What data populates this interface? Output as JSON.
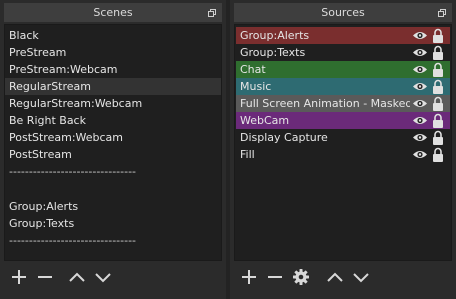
{
  "scenes": {
    "title": "Scenes",
    "items": [
      {
        "label": "Black",
        "selected": false
      },
      {
        "label": "PreStream",
        "selected": false
      },
      {
        "label": "PreStream:Webcam",
        "selected": false
      },
      {
        "label": "RegularStream",
        "selected": true
      },
      {
        "label": "RegularStream:Webcam",
        "selected": false
      },
      {
        "label": "Be Right Back",
        "selected": false
      },
      {
        "label": "PostStream:Webcam",
        "selected": false
      },
      {
        "label": "PostStream",
        "selected": false
      },
      {
        "label": "--------------------------------",
        "selected": false
      },
      {
        "label": "",
        "selected": false
      },
      {
        "label": "Group:Alerts",
        "selected": false
      },
      {
        "label": "Group:Texts",
        "selected": false
      },
      {
        "label": "--------------------------------",
        "selected": false
      }
    ],
    "toolbar": {
      "add_icon": "plus-icon",
      "remove_icon": "minus-icon",
      "up_icon": "chevron-up-icon",
      "down_icon": "chevron-down-icon"
    }
  },
  "sources": {
    "title": "Sources",
    "items": [
      {
        "label": "Group:Alerts",
        "color": "#7a2e2e"
      },
      {
        "label": "Group:Texts",
        "color": ""
      },
      {
        "label": "Chat",
        "color": "#2f6e2f"
      },
      {
        "label": "Music",
        "color": "#2e6b72"
      },
      {
        "label": "Full Screen Animation - Masked",
        "color": "#5a5a5a"
      },
      {
        "label": "WebCam",
        "color": "#6b2a7a"
      },
      {
        "label": "Display Capture",
        "color": ""
      },
      {
        "label": "Fill",
        "color": ""
      }
    ],
    "row_icons": {
      "visibility": "eye-icon",
      "lock": "lock-icon"
    },
    "toolbar": {
      "add_icon": "plus-icon",
      "remove_icon": "minus-icon",
      "properties_icon": "gear-icon",
      "up_icon": "chevron-up-icon",
      "down_icon": "chevron-down-icon"
    }
  }
}
